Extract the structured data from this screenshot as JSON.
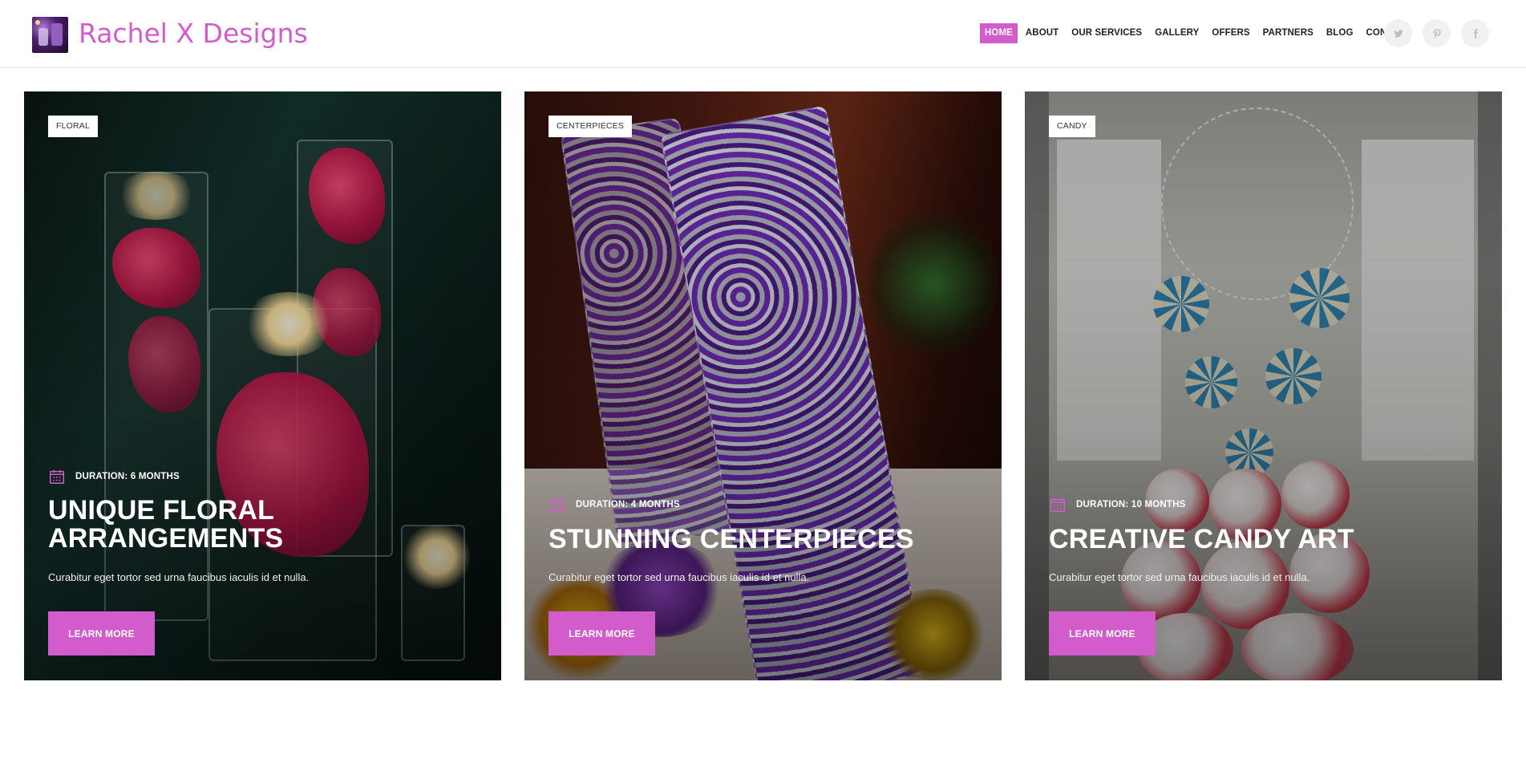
{
  "header": {
    "site_title": "Rachel X Designs",
    "logo_icon": "logo-image"
  },
  "nav": {
    "items": [
      {
        "label": "HOME",
        "active": true
      },
      {
        "label": "ABOUT",
        "active": false
      },
      {
        "label": "OUR SERVICES",
        "active": false
      },
      {
        "label": "GALLERY",
        "active": false
      },
      {
        "label": "OFFERS",
        "active": false
      },
      {
        "label": "PARTNERS",
        "active": false
      },
      {
        "label": "BLOG",
        "active": false
      },
      {
        "label": "CONTACT",
        "active": false
      }
    ]
  },
  "social": [
    "twitter-icon",
    "pinterest-icon",
    "facebook-icon"
  ],
  "colors": {
    "accent": "#d35ccd",
    "nav_text": "#222222",
    "social_bg": "#f1f1f1"
  },
  "cards": [
    {
      "tag": "FLORAL",
      "duration": "DURATION: 6 MONTHS",
      "title": "UNIQUE FLORAL ARRANGEMENTS",
      "description": "Curabitur eget tortor sed urna faucibus iaculis id et nulla.",
      "button": "LEARN MORE"
    },
    {
      "tag": "CENTERPIECES",
      "duration": "DURATION: 4 MONTHS",
      "title": "STUNNING CENTERPIECES",
      "description": "Curabitur eget tortor sed urna faucibus iaculis id et nulla.",
      "button": "LEARN MORE"
    },
    {
      "tag": "CANDY",
      "duration": "DURATION: 10 MONTHS",
      "title": "CREATIVE CANDY ART",
      "description": "Curabitur eget tortor sed urna faucibus iaculis id et nulla.",
      "button": "LEARN MORE"
    }
  ]
}
